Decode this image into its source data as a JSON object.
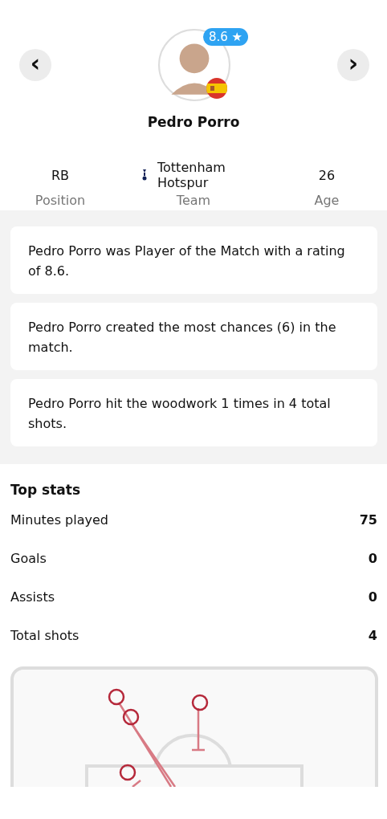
{
  "player": {
    "name": "Pedro Porro",
    "rating": "8.6",
    "rating_icon": "★",
    "prev": "‹",
    "next": "›"
  },
  "info": [
    {
      "kind": "plain",
      "value": "RB",
      "label": "Position"
    },
    {
      "kind": "team",
      "value": "Tottenham Hotspur",
      "label": "Team"
    },
    {
      "kind": "plain",
      "value": "26",
      "label": "Age"
    }
  ],
  "insights": [
    "Pedro Porro was Player of the Match with a rating of 8.6.",
    "Pedro Porro created the most chances (6) in the match.",
    "Pedro Porro hit the woodwork 1 times in 4 total shots."
  ],
  "top_stats": {
    "title": "Top stats",
    "rows": [
      {
        "label": "Minutes played",
        "value": "75"
      },
      {
        "label": "Goals",
        "value": "0"
      },
      {
        "label": "Assists",
        "value": "0"
      },
      {
        "label": "Total shots",
        "value": "4"
      }
    ]
  }
}
